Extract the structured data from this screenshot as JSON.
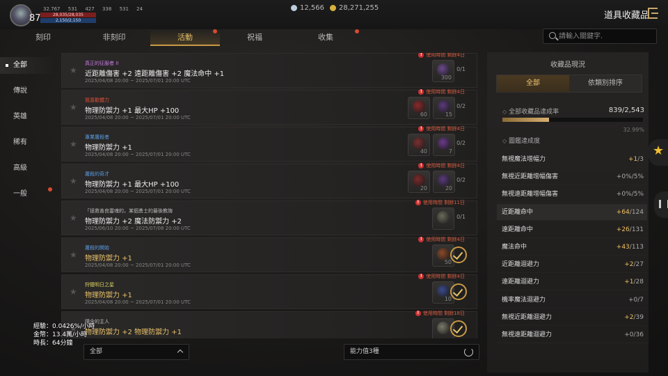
{
  "player": {
    "level": "87",
    "stats": [
      "32.767",
      "531",
      "427",
      "338",
      "531",
      "24"
    ],
    "hp": "28,035/28,035",
    "mp": "2,150/2,150"
  },
  "currency": {
    "diamonds": "12,566",
    "gold": "28,271,255"
  },
  "window": {
    "title": "道具收藏品"
  },
  "tabs": [
    "刻印",
    "非刻印",
    "活動",
    "祝福",
    "收集"
  ],
  "active_tab": "活動",
  "search": {
    "placeholder": "請輸入關鍵字."
  },
  "sidebar": [
    "全部",
    "傳說",
    "英雄",
    "稀有",
    "高級",
    "一般"
  ],
  "collections": [
    {
      "category": "真正的征服者 II",
      "cat_color": "#c678e0",
      "name": "近距離傷害 +2 遠距離傷害 +2 魔法命中 +1",
      "name_gold": false,
      "date": "2025/04/08 20:00 ~ 2025/07/01 20:00 UTC",
      "time_left": "使用時間 剩餘4日",
      "slots": [
        {
          "count": "300",
          "color": "#6a4a8a"
        }
      ],
      "progress": "0/1",
      "done": false
    },
    {
      "category": "我喜歡體力",
      "cat_color": "#e0503a",
      "name": "物理防禦力 +1 最大HP +100",
      "name_gold": false,
      "date": "2025/04/08 20:00 ~ 2025/07/01 20:00 UTC",
      "time_left": "使用時間 剩餘4日",
      "slots": [
        {
          "count": "60",
          "color": "#8a2a2a"
        },
        {
          "count": "15",
          "color": "#5a3a7a"
        }
      ],
      "progress": "0/2",
      "done": false
    },
    {
      "category": "專業屠殺者",
      "cat_color": "#5a9ae0",
      "name": "物理防禦力 +1",
      "name_gold": false,
      "date": "2025/04/08 20:00 ~ 2025/07/01 20:00 UTC",
      "time_left": "使用時間 剩餘4日",
      "slots": [
        {
          "count": "40",
          "color": "#7a3030"
        },
        {
          "count": "7",
          "color": "#6a3a8a"
        }
      ],
      "progress": "0/2",
      "done": false
    },
    {
      "category": "屠殺的奇才",
      "cat_color": "#5a9ae0",
      "name": "物理防禦力 +1 最大HP +100",
      "name_gold": false,
      "date": "2025/04/08 20:00 ~ 2025/07/01 20:00 UTC",
      "time_left": "使用時間 剩餘4日",
      "slots": [
        {
          "count": "20",
          "color": "#7a2a2a"
        },
        {
          "count": "20",
          "color": "#5a3a7a"
        }
      ],
      "progress": "0/2",
      "done": false
    },
    {
      "category": "「拯救善良靈魂的，某個勇士的最後教誨",
      "cat_color": "#bbbbbb",
      "name": "物理防禦力 +2 魔法防禦力 +2",
      "name_gold": false,
      "date": "2025/06/10 20:00 ~ 2025/07/08 20:00 UTC",
      "time_left": "使用時間 剩餘11日",
      "slots": [
        {
          "count": "",
          "color": "#6a6a5a"
        }
      ],
      "progress": "0/1",
      "done": false
    },
    {
      "category": "屠殺的開始",
      "cat_color": "#5a9ae0",
      "name": "物理防禦力 +1",
      "name_gold": true,
      "date": "2025/04/08 20:00 ~ 2025/07/01 20:00 UTC",
      "time_left": "使用時間 剩餘4日",
      "slots": [
        {
          "count": "50",
          "color": "#8a4a2a"
        }
      ],
      "progress": "",
      "done": true
    },
    {
      "category": "狩獵明日之星",
      "cat_color": "#d8d060",
      "name": "物理防禦力 +1",
      "name_gold": true,
      "date": "2025/04/08 20:00 ~ 2025/07/01 20:00 UTC",
      "time_left": "使用時間 剩餘4日",
      "slots": [
        {
          "count": "10",
          "color": "#3a4a8a"
        }
      ],
      "progress": "",
      "done": true
    },
    {
      "category": "隱含的主人",
      "cat_color": "#bbbbbb",
      "name": "物理防禦力 +2 物理防禦力 +1",
      "name_gold": true,
      "date": "",
      "time_left": "使用時間 剩餘18日",
      "slots": [
        {
          "count": "",
          "color": "#7a7a6a"
        }
      ],
      "progress": "",
      "done": true
    }
  ],
  "filters": {
    "grade": "全部",
    "ability": "能力值3種"
  },
  "info": {
    "exp": "經驗：0.0426%/小時",
    "gold": "金幣：13.4萬/小時",
    "duration": "時長：64分鐘"
  },
  "status_panel": {
    "title": "收藏品現況",
    "segments": [
      "全部",
      "依類別排序"
    ],
    "completion_label": "全部收藏品達成率",
    "completion_value": "839/2,543",
    "completion_percent": "32.99%",
    "completion_fraction": 0.3299,
    "codex_label": "圖鑑達成度",
    "stats": [
      {
        "name": "無視魔法增幅力",
        "gain": "+1",
        "max": "/3",
        "hl": true
      },
      {
        "name": "無視近距離增幅傷害",
        "gain": "+0%",
        "max": "/5%",
        "hl": false
      },
      {
        "name": "無視遠距離增幅傷害",
        "gain": "+0%",
        "max": "/5%",
        "hl": false
      },
      {
        "name": "近距離命中",
        "gain": "+64",
        "max": "/124",
        "hl": true
      },
      {
        "name": "遠距離命中",
        "gain": "+26",
        "max": "/131",
        "hl": true
      },
      {
        "name": "魔法命中",
        "gain": "+43",
        "max": "/113",
        "hl": true
      },
      {
        "name": "近距離迴避力",
        "gain": "+2",
        "max": "/27",
        "hl": true
      },
      {
        "name": "遠距離迴避力",
        "gain": "+1",
        "max": "/28",
        "hl": true
      },
      {
        "name": "機率魔法迴避力",
        "gain": "+0",
        "max": "/7",
        "hl": false
      },
      {
        "name": "無視近距離迴避力",
        "gain": "+2",
        "max": "/39",
        "hl": true
      },
      {
        "name": "無視遠距離迴避力",
        "gain": "+0",
        "max": "/36",
        "hl": false
      }
    ]
  }
}
